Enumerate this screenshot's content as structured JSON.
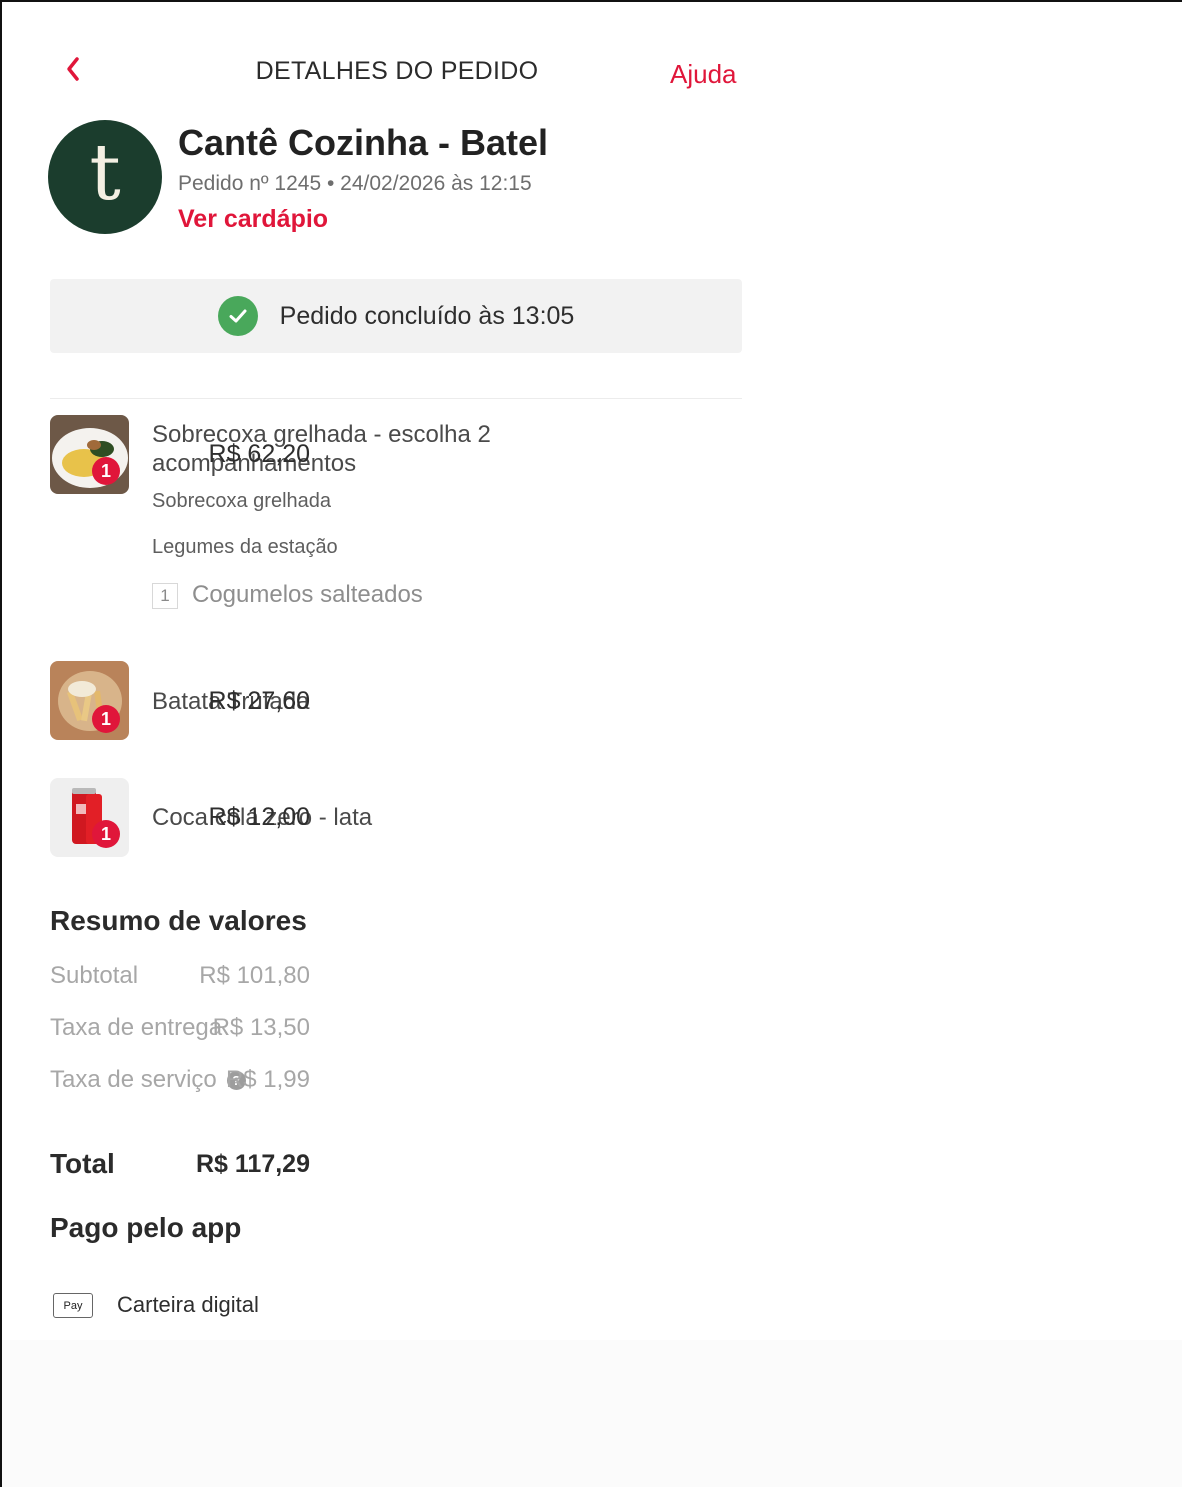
{
  "header": {
    "title": "DETALHES DO PEDIDO",
    "help_label": "Ajuda"
  },
  "store": {
    "logo_letter": "t",
    "name": "Cantê Cozinha - Batel",
    "order_meta": "Pedido nº 1245 • 24/02/2026 às 12:15",
    "menu_link": "Ver cardápio"
  },
  "status": {
    "text": "Pedido concluído às 13:05"
  },
  "items": [
    {
      "name_line1": "Sobrecoxa grelhada -  escolha 2",
      "name_line2": "acompanhamentos",
      "price": "R$ 62,20",
      "quantity": "1",
      "options": [
        "Sobrecoxa grelhada",
        "Legumes da estação"
      ],
      "extra": {
        "quantity": "1",
        "name": "Cogumelos salteados"
      }
    },
    {
      "name": "Batata Trufada",
      "price": "R$ 27,60",
      "quantity": "1"
    },
    {
      "name": "Coca cola zero - lata",
      "price": "R$ 12,00",
      "quantity": "1"
    }
  ],
  "summary": {
    "title": "Resumo de valores",
    "subtotal_label": "Subtotal",
    "subtotal_value": "R$ 101,80",
    "delivery_label": "Taxa de entrega",
    "delivery_value": "R$ 13,50",
    "service_label": "Taxa de serviço",
    "service_value": "R$ 1,99",
    "total_label": "Total",
    "total_value": "R$ 117,29"
  },
  "payment": {
    "title": "Pago pelo app",
    "badge": "Pay",
    "method": "Carteira digital"
  },
  "colors": {
    "accent": "#e0163a",
    "success": "#49a85b",
    "logo_bg": "#1b3d2d"
  }
}
